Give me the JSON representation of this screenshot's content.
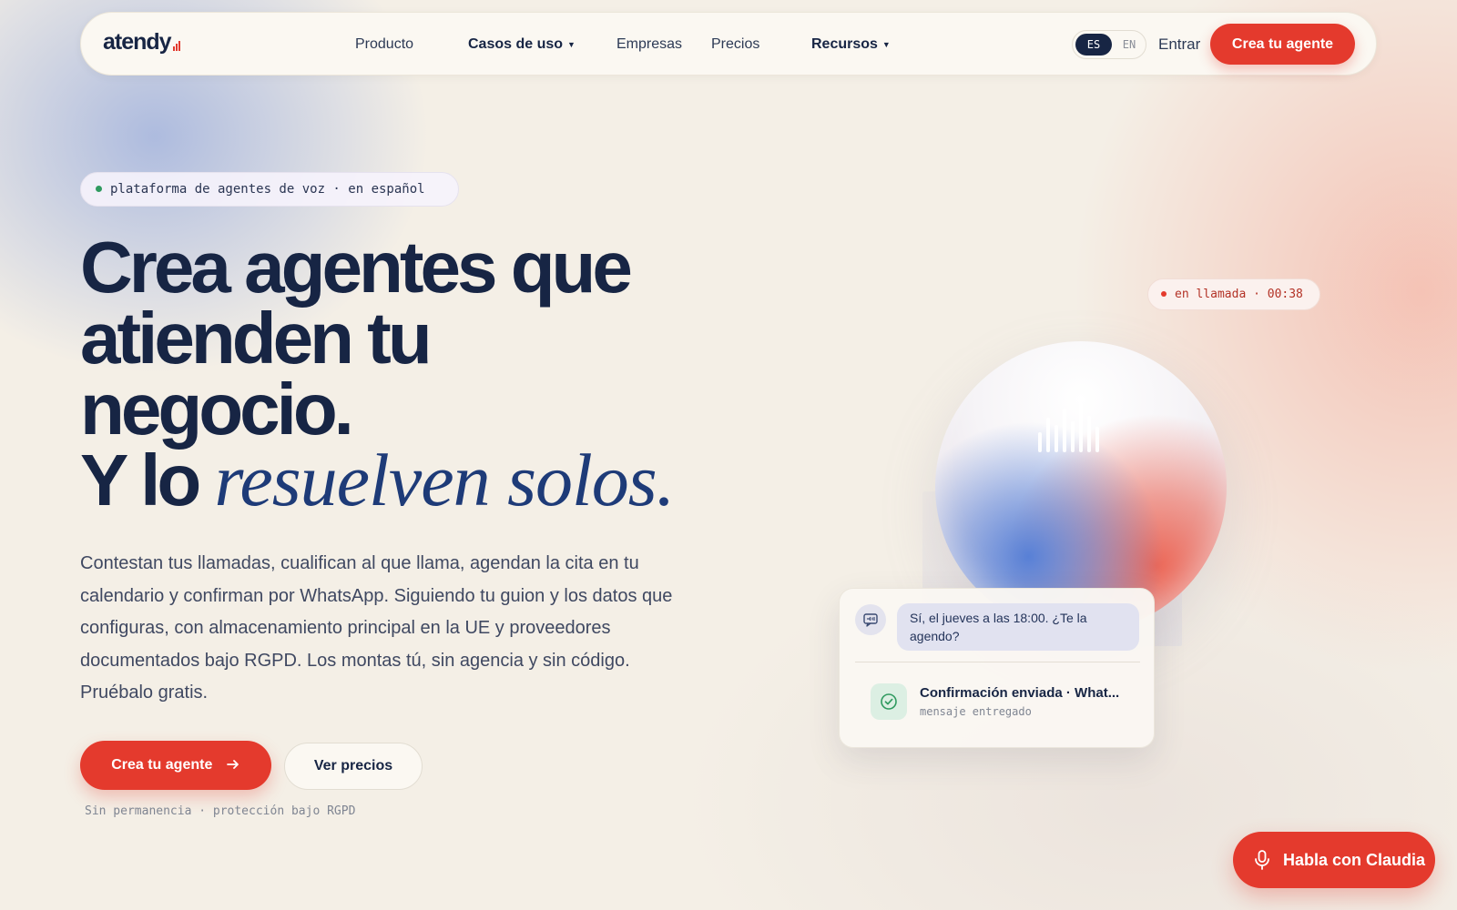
{
  "nav": {
    "logo": "atendy",
    "items": [
      {
        "label": "Producto",
        "bold": false
      },
      {
        "label": "Casos de uso",
        "bold": true,
        "dropdown": true
      },
      {
        "label": "Empresas",
        "bold": false
      },
      {
        "label": "Precios",
        "bold": false
      },
      {
        "label": "Recursos",
        "bold": true,
        "dropdown": true
      }
    ],
    "lang": {
      "active": "ES",
      "other": "EN"
    },
    "login": "Entrar",
    "cta": "Crea tu agente"
  },
  "hero": {
    "pill": "plataforma de agentes de voz · en español",
    "title_lines": [
      "Crea agentes que",
      "atienden tu",
      "negocio."
    ],
    "title_last_prefix": "Y lo",
    "title_last_italic": "resuelven solos.",
    "description": "Contestan tus llamadas, cualifican al que llama, agendan la cita en tu calendario y confirman por WhatsApp. Siguiendo tu guion y los datos que configuras, con almacenamiento principal en la UE y proveedores documentados bajo RGPD. Los montas tú, sin agencia y sin código. Pruébalo gratis.",
    "primary_cta": "Crea tu agente",
    "secondary_cta": "Ver precios",
    "note": "Sin permanencia · protección bajo RGPD"
  },
  "demo": {
    "call_status": "en llamada · 00:38",
    "agent_message": "Sí, el jueves a las 18:00. ¿Te la agendo?",
    "confirmation_title": "Confirmación enviada · What...",
    "confirmation_sub": "mensaje entregado"
  },
  "floating": {
    "label": "Habla con Claudia"
  },
  "colors": {
    "accent": "#e43a2d",
    "navy": "#172544",
    "italic_blue": "#1e3b78",
    "background": "#f4efe6",
    "success": "#2f9a5f"
  },
  "icons": [
    "chevron-down-icon",
    "arrow-right-icon",
    "chat-icon",
    "check-circle-icon",
    "microphone-icon",
    "soundwave-icon"
  ]
}
